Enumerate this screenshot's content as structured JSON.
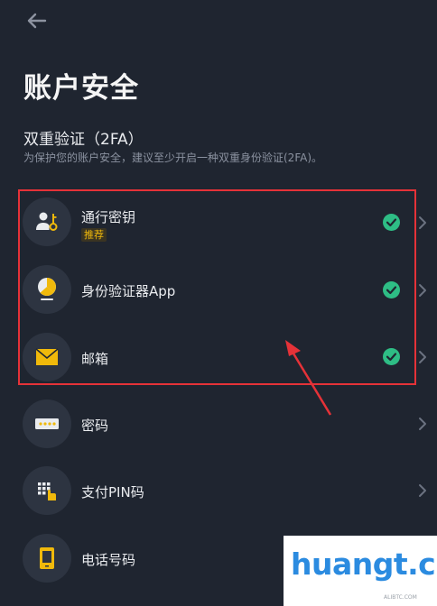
{
  "header": {
    "title": "账户安全"
  },
  "twofa": {
    "title": "双重验证（2FA）",
    "description": "为保护您的账户安全，建议至少开启一种双重身份验证(2FA)。"
  },
  "items": [
    {
      "label": "通行密钥",
      "badge": "推荐",
      "verified": true,
      "icon": "passkey-icon"
    },
    {
      "label": "身份验证器App",
      "verified": true,
      "icon": "authenticator-icon"
    },
    {
      "label": "邮箱",
      "verified": true,
      "icon": "envelope-icon"
    },
    {
      "label": "密码",
      "verified": false,
      "icon": "password-icon"
    },
    {
      "label": "支付PIN码",
      "verified": false,
      "icon": "keypad-icon"
    },
    {
      "label": "电话号码",
      "verified": false,
      "icon": "phone-icon"
    }
  ],
  "watermark": {
    "text": "huangt.cn",
    "subtext": "ALIBTC.COM"
  },
  "colors": {
    "accent": "#f0b90b",
    "success": "#2ebd85",
    "highlight": "#e53238",
    "background": "#1f2530"
  }
}
